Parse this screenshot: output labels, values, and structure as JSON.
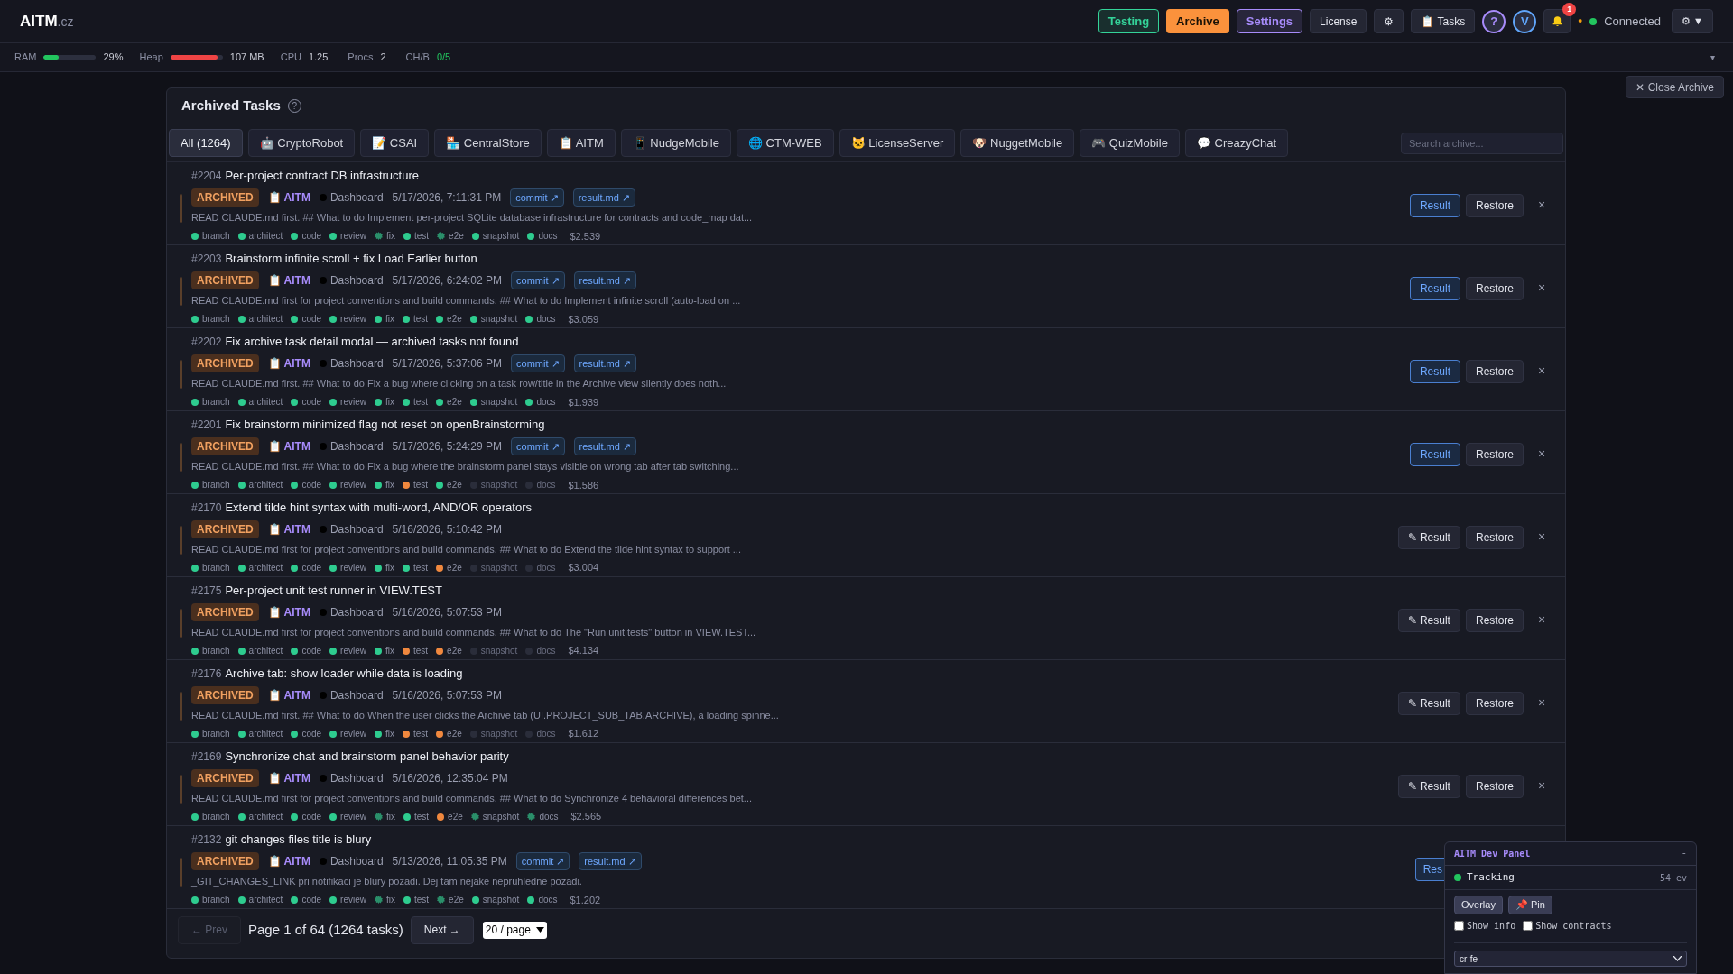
{
  "topbar": {
    "logo": "AITM",
    "logo_suffix": ".cz",
    "nav": [
      {
        "label": "Testing",
        "kind": "outline",
        "color": "#34d399"
      },
      {
        "label": "Archive",
        "kind": "filled",
        "color": "#fb923c"
      },
      {
        "label": "Settings",
        "kind": "outline",
        "color": "#a78bfa"
      },
      {
        "label": "License",
        "kind": "plain"
      },
      {
        "label": "⚙",
        "kind": "plain"
      },
      {
        "label": "📋 Tasks",
        "kind": "plain"
      },
      {
        "label": "?",
        "kind": "circle",
        "color": "#a78bfa"
      },
      {
        "label": "V",
        "kind": "circle",
        "color": "#60a5fa"
      }
    ],
    "notifications": {
      "badge": "1"
    },
    "activity_dot": "•",
    "connection": "Connected",
    "menu": "⚙ ▼"
  },
  "stats": [
    {
      "label": "RAM",
      "value": "29%",
      "kind": "meter",
      "level": 0.29,
      "color": "#22c55e"
    },
    {
      "label": "Heap",
      "value": "107 MB",
      "kind": "meter",
      "level": 0.9,
      "color": "#ef4444"
    },
    {
      "label": "CPU",
      "value": "1.25",
      "kind": "plain"
    },
    {
      "label": "Procs",
      "value": "2",
      "kind": "plain"
    },
    {
      "label": "CH/B",
      "value": "0/5",
      "kind": "good"
    }
  ],
  "stats_toggle": "▾",
  "close_archive": "✕ Close Archive",
  "panel": {
    "title": "Archived Tasks",
    "help": "?",
    "filters": [
      {
        "label": "All (1264)",
        "selected": true
      },
      {
        "label": "🤖 CryptoRobot",
        "selected": false
      },
      {
        "label": "📝 CSAI",
        "selected": false
      },
      {
        "label": "🏪 CentralStore",
        "selected": false
      },
      {
        "label": "📋 AITM",
        "selected": false
      },
      {
        "label": "📱 NudgeMobile",
        "selected": false
      },
      {
        "label": "🌐 CTM-WEB",
        "selected": false
      },
      {
        "label": "🐱 LicenseServer",
        "selected": false
      },
      {
        "label": "🐶 NuggetMobile",
        "selected": false
      },
      {
        "label": "🎮 QuizMobile",
        "selected": false
      },
      {
        "label": "💬 CreazyChat",
        "selected": false
      }
    ],
    "search": {
      "placeholder": "Search archive..."
    },
    "tasks": [
      {
        "id": "#2204",
        "title": "Per-project contract DB infrastructure",
        "status": "ARCHIVED",
        "project": "📋 AITM",
        "page": "Dashboard",
        "date": "5/17/2026, 7:11:31 PM",
        "links": [
          "commit ↗",
          "result.md ↗"
        ],
        "description": "READ CLAUDE.md first. ## What to do Implement per-project SQLite database infrastructure for contracts and code_map dat...",
        "steps": [
          {
            "label": "branch",
            "kind": "done"
          },
          {
            "label": "architect",
            "kind": "done"
          },
          {
            "label": "code",
            "kind": "done"
          },
          {
            "label": "review",
            "kind": "done"
          },
          {
            "label": "fix",
            "kind": "running"
          },
          {
            "label": "test",
            "kind": "done"
          },
          {
            "label": "e2e",
            "kind": "running"
          },
          {
            "label": "snapshot",
            "kind": "done"
          },
          {
            "label": "docs",
            "kind": "done"
          }
        ],
        "cost": "$2.539",
        "result": {
          "label": "Result",
          "kind": "ready"
        },
        "restore": "Restore",
        "close": "×"
      },
      {
        "id": "#2203",
        "title": "Brainstorm infinite scroll + fix Load Earlier button",
        "status": "ARCHIVED",
        "project": "📋 AITM",
        "page": "Dashboard",
        "date": "5/17/2026, 6:24:02 PM",
        "links": [
          "commit ↗",
          "result.md ↗"
        ],
        "description": "READ CLAUDE.md first for project conventions and build commands. ## What to do Implement infinite scroll (auto-load on ...",
        "steps": [
          {
            "label": "branch",
            "kind": "done"
          },
          {
            "label": "architect",
            "kind": "done"
          },
          {
            "label": "code",
            "kind": "done"
          },
          {
            "label": "review",
            "kind": "done"
          },
          {
            "label": "fix",
            "kind": "done"
          },
          {
            "label": "test",
            "kind": "done"
          },
          {
            "label": "e2e",
            "kind": "done"
          },
          {
            "label": "snapshot",
            "kind": "done"
          },
          {
            "label": "docs",
            "kind": "done"
          }
        ],
        "cost": "$3.059",
        "result": {
          "label": "Result",
          "kind": "ready"
        },
        "restore": "Restore",
        "close": "×"
      },
      {
        "id": "#2202",
        "title": "Fix archive task detail modal — archived tasks not found",
        "status": "ARCHIVED",
        "project": "📋 AITM",
        "page": "Dashboard",
        "date": "5/17/2026, 5:37:06 PM",
        "links": [
          "commit ↗",
          "result.md ↗"
        ],
        "description": "READ CLAUDE.md first. ## What to do Fix a bug where clicking on a task row/title in the Archive view silently does noth...",
        "steps": [
          {
            "label": "branch",
            "kind": "done"
          },
          {
            "label": "architect",
            "kind": "done"
          },
          {
            "label": "code",
            "kind": "done"
          },
          {
            "label": "review",
            "kind": "done"
          },
          {
            "label": "fix",
            "kind": "done"
          },
          {
            "label": "test",
            "kind": "done"
          },
          {
            "label": "e2e",
            "kind": "done"
          },
          {
            "label": "snapshot",
            "kind": "done"
          },
          {
            "label": "docs",
            "kind": "done"
          }
        ],
        "cost": "$1.939",
        "result": {
          "label": "Result",
          "kind": "ready"
        },
        "restore": "Restore",
        "close": "×"
      },
      {
        "id": "#2201",
        "title": "Fix brainstorm minimized flag not reset on openBrainstorming",
        "status": "ARCHIVED",
        "project": "📋 AITM",
        "page": "Dashboard",
        "date": "5/17/2026, 5:24:29 PM",
        "links": [
          "commit ↗",
          "result.md ↗"
        ],
        "description": "READ CLAUDE.md first. ## What to do Fix a bug where the brainstorm panel stays visible on wrong tab after tab switching...",
        "steps": [
          {
            "label": "branch",
            "kind": "done"
          },
          {
            "label": "architect",
            "kind": "done"
          },
          {
            "label": "code",
            "kind": "done"
          },
          {
            "label": "review",
            "kind": "done"
          },
          {
            "label": "fix",
            "kind": "done"
          },
          {
            "label": "test",
            "kind": "warning"
          },
          {
            "label": "e2e",
            "kind": "done"
          },
          {
            "label": "snapshot",
            "kind": "off"
          },
          {
            "label": "docs",
            "kind": "off"
          }
        ],
        "cost": "$1.586",
        "result": {
          "label": "Result",
          "kind": "ready"
        },
        "restore": "Restore",
        "close": "×"
      },
      {
        "id": "#2170",
        "title": "Extend tilde hint syntax with multi-word, AND/OR operators",
        "status": "ARCHIVED",
        "project": "📋 AITM",
        "page": "Dashboard",
        "date": "5/16/2026, 5:10:42 PM",
        "description": "READ CLAUDE.md first for project conventions and build commands. ## What to do Extend the tilde hint syntax to support ...",
        "steps": [
          {
            "label": "branch",
            "kind": "done"
          },
          {
            "label": "architect",
            "kind": "done"
          },
          {
            "label": "code",
            "kind": "done"
          },
          {
            "label": "review",
            "kind": "done"
          },
          {
            "label": "fix",
            "kind": "done"
          },
          {
            "label": "test",
            "kind": "done"
          },
          {
            "label": "e2e",
            "kind": "warning"
          },
          {
            "label": "snapshot",
            "kind": "off"
          },
          {
            "label": "docs",
            "kind": "off"
          }
        ],
        "cost": "$3.004",
        "result": {
          "label": "✎ Result",
          "kind": "edit"
        },
        "restore": "Restore",
        "close": "×"
      },
      {
        "id": "#2175",
        "title": "Per-project unit test runner in VIEW.TEST",
        "status": "ARCHIVED",
        "project": "📋 AITM",
        "page": "Dashboard",
        "date": "5/16/2026, 5:07:53 PM",
        "description": "READ CLAUDE.md first for project conventions and build commands. ## What to do The \"Run unit tests\" button in VIEW.TEST...",
        "steps": [
          {
            "label": "branch",
            "kind": "done"
          },
          {
            "label": "architect",
            "kind": "done"
          },
          {
            "label": "code",
            "kind": "done"
          },
          {
            "label": "review",
            "kind": "done"
          },
          {
            "label": "fix",
            "kind": "done"
          },
          {
            "label": "test",
            "kind": "warning"
          },
          {
            "label": "e2e",
            "kind": "warning"
          },
          {
            "label": "snapshot",
            "kind": "off"
          },
          {
            "label": "docs",
            "kind": "off"
          }
        ],
        "cost": "$4.134",
        "result": {
          "label": "✎ Result",
          "kind": "edit"
        },
        "restore": "Restore",
        "close": "×"
      },
      {
        "id": "#2176",
        "title": "Archive tab: show loader while data is loading",
        "status": "ARCHIVED",
        "project": "📋 AITM",
        "page": "Dashboard",
        "date": "5/16/2026, 5:07:53 PM",
        "description": "READ CLAUDE.md first. ## What to do When the user clicks the Archive tab (UI.PROJECT_SUB_TAB.ARCHIVE), a loading spinne...",
        "steps": [
          {
            "label": "branch",
            "kind": "done"
          },
          {
            "label": "architect",
            "kind": "done"
          },
          {
            "label": "code",
            "kind": "done"
          },
          {
            "label": "review",
            "kind": "done"
          },
          {
            "label": "fix",
            "kind": "done"
          },
          {
            "label": "test",
            "kind": "warning"
          },
          {
            "label": "e2e",
            "kind": "warning"
          },
          {
            "label": "snapshot",
            "kind": "off"
          },
          {
            "label": "docs",
            "kind": "off"
          }
        ],
        "cost": "$1.612",
        "result": {
          "label": "✎ Result",
          "kind": "edit"
        },
        "restore": "Restore",
        "close": "×"
      },
      {
        "id": "#2169",
        "title": "Synchronize chat and brainstorm panel behavior parity",
        "status": "ARCHIVED",
        "project": "📋 AITM",
        "page": "Dashboard",
        "date": "5/16/2026, 12:35:04 PM",
        "description": "READ CLAUDE.md first for project conventions and build commands. ## What to do Synchronize 4 behavioral differences bet...",
        "steps": [
          {
            "label": "branch",
            "kind": "done"
          },
          {
            "label": "architect",
            "kind": "done"
          },
          {
            "label": "code",
            "kind": "done"
          },
          {
            "label": "review",
            "kind": "done"
          },
          {
            "label": "fix",
            "kind": "running"
          },
          {
            "label": "test",
            "kind": "done"
          },
          {
            "label": "e2e",
            "kind": "warning"
          },
          {
            "label": "snapshot",
            "kind": "running"
          },
          {
            "label": "docs",
            "kind": "running"
          }
        ],
        "cost": "$2.565",
        "result": {
          "label": "✎ Result",
          "kind": "edit"
        },
        "restore": "Restore",
        "close": "×"
      },
      {
        "id": "#2132",
        "title": "git changes files title is blury",
        "status": "ARCHIVED",
        "project": "📋 AITM",
        "page": "Dashboard",
        "date": "5/13/2026, 11:05:35 PM",
        "links": [
          "commit ↗",
          "result.md ↗"
        ],
        "description": "_GIT_CHANGES_LINK pri notifikaci je blury pozadi. Dej tam nejake nepruhledne pozadi.",
        "steps": [
          {
            "label": "branch",
            "kind": "done"
          },
          {
            "label": "architect",
            "kind": "done"
          },
          {
            "label": "code",
            "kind": "done"
          },
          {
            "label": "review",
            "kind": "done"
          },
          {
            "label": "fix",
            "kind": "running"
          },
          {
            "label": "test",
            "kind": "done"
          },
          {
            "label": "e2e",
            "kind": "running"
          },
          {
            "label": "snapshot",
            "kind": "done"
          },
          {
            "label": "docs",
            "kind": "done"
          }
        ],
        "cost": "$1.202",
        "result": {
          "label": "Res",
          "kind": "ready"
        }
      }
    ],
    "pagination": {
      "prev": {
        "label": "← Prev",
        "disabled": true
      },
      "info": "Page 1 of 64 (1264 tasks)",
      "next": {
        "label": "Next →",
        "disabled": false
      },
      "page_size": "20 / page"
    }
  },
  "dev_panel": {
    "title": "AITM Dev Panel",
    "minimize": "-",
    "status": "Tracking",
    "count": "54 ev",
    "buttons": [
      "Overlay",
      "📌 Pin"
    ],
    "options": [
      {
        "label": "Show info",
        "checked": false
      },
      {
        "label": "Show contracts",
        "checked": false
      }
    ],
    "select": "cr-fe"
  }
}
